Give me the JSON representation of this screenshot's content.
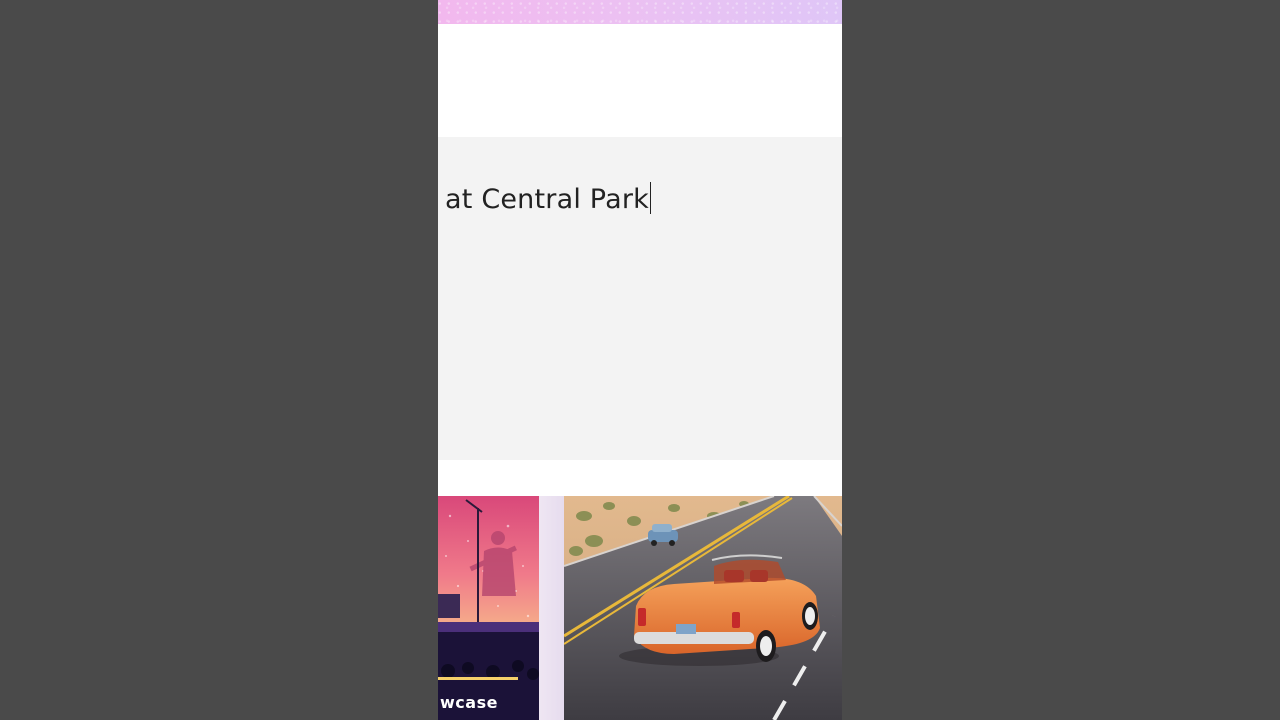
{
  "prompt": {
    "text": "at Central Park"
  },
  "gallery": {
    "cards": [
      {
        "caption": "wcase",
        "image": "concert-stage-illustration"
      },
      {
        "caption": "",
        "image": "vintage-orange-convertible-desert-road"
      }
    ]
  },
  "colors": {
    "outer_background": "#4a4a4a",
    "prompt_background": "#f3f3f3",
    "banner_pink": "#f2b8ee"
  }
}
